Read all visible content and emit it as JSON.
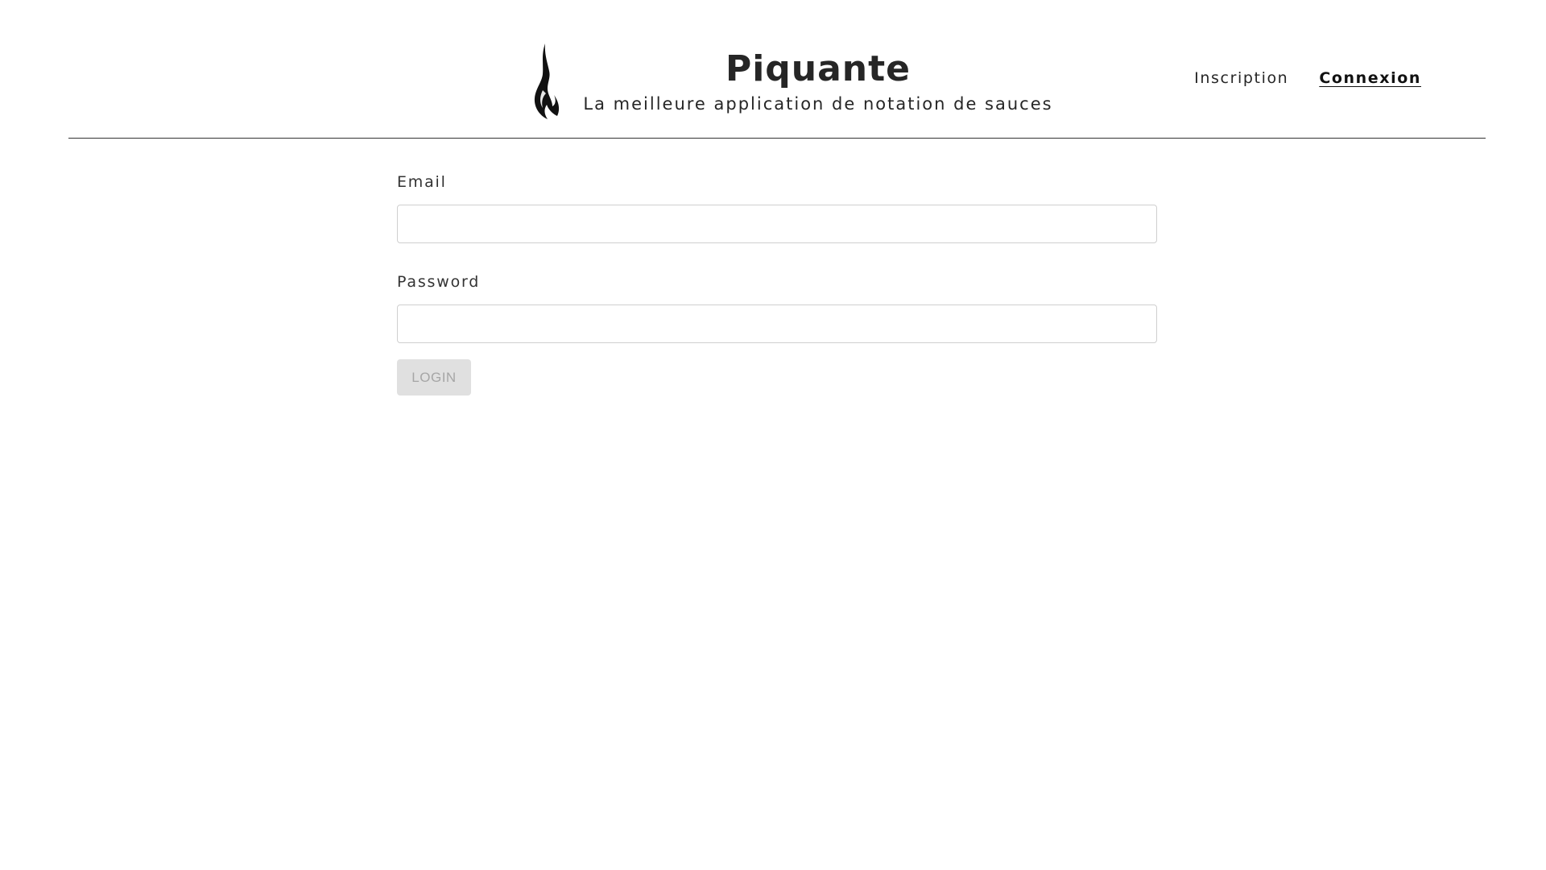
{
  "header": {
    "title": "Piquante",
    "subtitle": "La meilleure application de notation de sauces",
    "logo_icon": "flame-icon",
    "nav": {
      "signup_label": "Inscription",
      "login_label": "Connexion",
      "active": "Connexion"
    }
  },
  "login_form": {
    "email_label": "Email",
    "email_value": "",
    "email_placeholder": "",
    "password_label": "Password",
    "password_value": "",
    "password_placeholder": "",
    "submit_label": "LOGIN",
    "submit_disabled": true
  },
  "colors": {
    "text": "#262626",
    "divider": "#333333",
    "input_border": "#cfcfcf",
    "button_disabled_bg": "#e0e0e0",
    "button_disabled_text": "#a6a6a6"
  }
}
